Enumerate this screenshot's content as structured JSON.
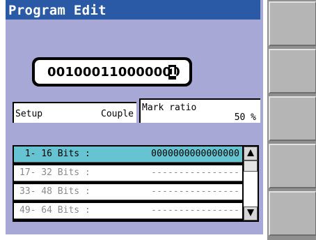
{
  "title": "Program Edit",
  "pattern": {
    "value": "001000110000000",
    "cursor_char": "1"
  },
  "setup": {
    "label": "Setup",
    "value": "Couple"
  },
  "mark_ratio": {
    "label": "Mark ratio",
    "value": "50 %"
  },
  "bit_rows": [
    {
      "label": " 1- 16 Bits :",
      "value": "0000000000000000",
      "selected": true
    },
    {
      "label": "17- 32 Bits :",
      "value": "----------------",
      "selected": false
    },
    {
      "label": "33- 48 Bits :",
      "value": "----------------",
      "selected": false
    },
    {
      "label": "49- 64 Bits :",
      "value": "----------------",
      "selected": false
    }
  ],
  "softkeys": [
    "",
    "",
    "",
    "",
    ""
  ],
  "colors": {
    "title_bar": "#2a5aa6",
    "panel": "#a7a8d6",
    "selected_row": "#66c4d2"
  }
}
